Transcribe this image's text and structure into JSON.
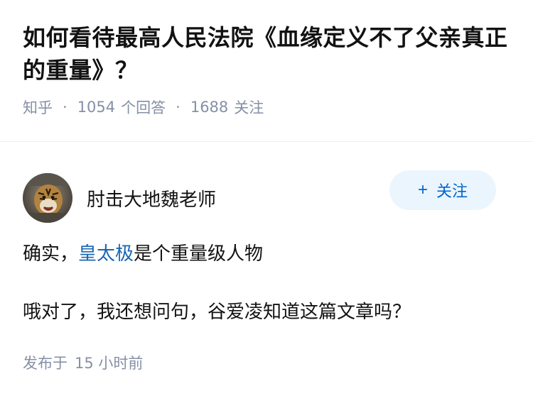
{
  "question": {
    "title": "如何看待最高人民法院《血缘定义不了父亲真正的重量》？",
    "source": "知乎",
    "answer_count": "1054",
    "answer_label": "个回答",
    "follower_count": "1688",
    "follower_label": "关注"
  },
  "answer": {
    "author_name": "肘击大地魏老师",
    "follow_label": "关注",
    "follow_icon": "plus-icon",
    "paragraph1": {
      "prefix": "确实，",
      "link": "皇太极",
      "suffix": "是个重量级人物"
    },
    "paragraph2": "哦对了，我还想问句，谷爱凌知道这篇文章吗？",
    "publish_label": "发布于",
    "publish_time": "15 小时前"
  },
  "colors": {
    "link": "#1a66b3",
    "meta": "#8590a6",
    "follow_bg": "#ebf5fd",
    "follow_text": "#0066cc"
  }
}
